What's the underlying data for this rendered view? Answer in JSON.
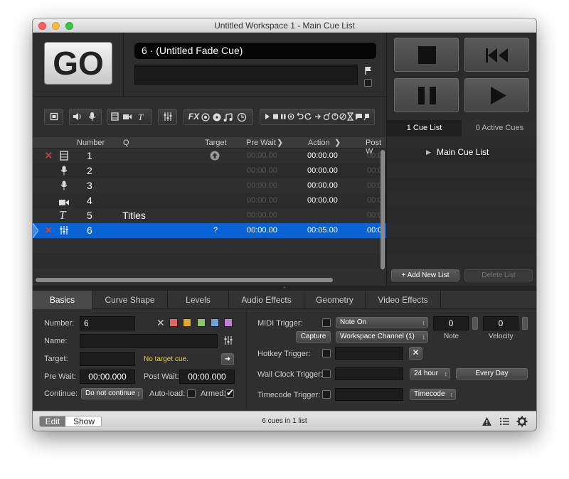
{
  "window": {
    "title": "Untitled Workspace 1 - Main Cue List"
  },
  "go": {
    "label": "GO"
  },
  "cue_name": "6 · (Untitled Fade Cue)",
  "toolbar": {
    "fx_label": "FX"
  },
  "table": {
    "headers": {
      "number": "Number",
      "q": "Q",
      "target": "Target",
      "prewait": "Pre Wait",
      "action": "Action",
      "postwait": "Post W"
    },
    "rows": [
      {
        "number": "1",
        "q": "",
        "target": "",
        "prewait": "00:00.00",
        "action": "00:00.00",
        "postwait": "00:0",
        "type": "video-icon",
        "broken": true,
        "selected": false
      },
      {
        "number": "2",
        "q": "",
        "target": "",
        "prewait": "00:00.00",
        "action": "00:00.00",
        "postwait": "00:0",
        "type": "mic-icon",
        "broken": false,
        "selected": false
      },
      {
        "number": "3",
        "q": "",
        "target": "",
        "prewait": "00:00.00",
        "action": "00:00.00",
        "postwait": "00:0",
        "type": "mic-icon",
        "broken": false,
        "selected": false
      },
      {
        "number": "4",
        "q": "",
        "target": "",
        "prewait": "00:00.00",
        "action": "00:00.00",
        "postwait": "00:0",
        "type": "camera-icon",
        "broken": false,
        "selected": false
      },
      {
        "number": "5",
        "q": "Titles",
        "target": "",
        "prewait": "00:00.00",
        "action": "",
        "postwait": "00:0",
        "type": "text-icon",
        "broken": false,
        "selected": false
      },
      {
        "number": "6",
        "q": "",
        "target": "?",
        "prewait": "00:00.00",
        "action": "00:05.00",
        "postwait": "00:0",
        "type": "fader-icon",
        "broken": true,
        "selected": true
      }
    ]
  },
  "right_panel": {
    "tabs": [
      "1 Cue List",
      "0 Active Cues"
    ],
    "lists": [
      "Main Cue List"
    ],
    "add_button": "+ Add New List",
    "delete_button": "Delete List"
  },
  "inspector": {
    "tabs": [
      "Basics",
      "Curve Shape",
      "Levels",
      "Audio Effects",
      "Geometry",
      "Video Effects"
    ],
    "active_tab": "Basics",
    "number_label": "Number:",
    "number_value": "6",
    "name_label": "Name:",
    "name_value": "",
    "target_label": "Target:",
    "target_value": "",
    "no_target": "No target cue.",
    "prewait_label": "Pre Wait:",
    "prewait_value": "00:00.000",
    "postwait_label": "Post Wait:",
    "postwait_value": "00:00.000",
    "continue_label": "Continue:",
    "continue_value": "Do not continue",
    "autoload_label": "Auto-load:",
    "armed_label": "Armed:",
    "armed": true,
    "autoload": false,
    "color_swatches": [
      "#e06666",
      "#e6a82b",
      "#8dc56c",
      "#6fa2d8",
      "#c27fd6"
    ],
    "midi_label": "MIDI Trigger:",
    "midi_type": "Note On",
    "midi_channel": "Workspace Channel (1)",
    "capture_button": "Capture",
    "note_value": "0",
    "note_label": "Note",
    "velocity_value": "0",
    "velocity_label": "Velocity",
    "hotkey_label": "Hotkey Trigger:",
    "wallclock_label": "Wall Clock Trigger:",
    "wallclock_mode": "24 hour",
    "wallclock_days": "Every Day",
    "timecode_label": "Timecode Trigger:",
    "timecode_value": "Timecode"
  },
  "statusbar": {
    "modes": [
      "Edit",
      "Show"
    ],
    "active_mode": "Edit",
    "summary": "6 cues in 1 list"
  },
  "colors": {
    "selection": "#0a63d4",
    "broken": "#e0403a",
    "no_target": "#e6d23b",
    "close": "#fc605c",
    "minimize": "#fdbc40",
    "zoom": "#34c84a"
  }
}
